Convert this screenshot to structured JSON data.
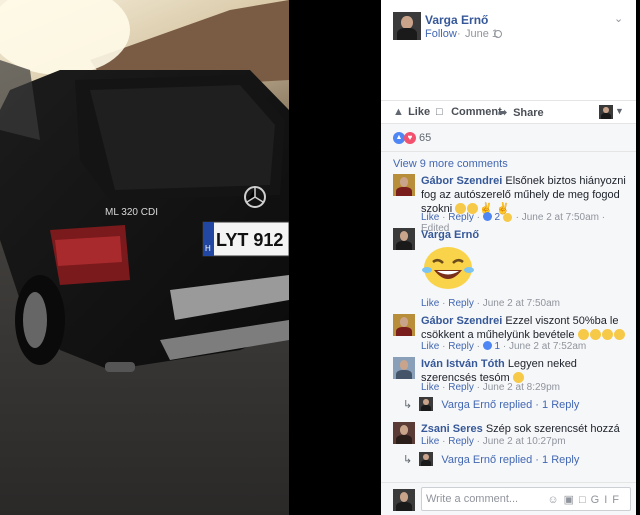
{
  "post": {
    "author": "Varga Ernő",
    "follow_label": "Follow",
    "dot": "·",
    "date": "June 1",
    "menu_icon": "chevron-down-icon"
  },
  "photo": {
    "plate_text": "LYT 912",
    "model_badge": "ML 320 CDI",
    "plate_country": "H"
  },
  "actions": {
    "like": "Like",
    "comment": "Comment",
    "share": "Share"
  },
  "reactions": {
    "count": "65"
  },
  "comments": {
    "view_more": "View 9 more comments",
    "items": [
      {
        "name": "Gábor Szendrei",
        "text": "Elsőnek biztos hiányozni fog az autószerelő műhely de meg fogod szokni",
        "like": "Like",
        "reply": "Reply",
        "reaction_count": "2",
        "time": "June 2 at 7:50am",
        "edited": "Edited"
      },
      {
        "name": "Varga Ernő",
        "text": "",
        "like": "Like",
        "reply": "Reply",
        "time": "June 2 at 7:50am"
      },
      {
        "name": "Gábor Szendrei",
        "text": "Ezzel viszont 50%ba le csökkent a műhelyünk bevétele",
        "like": "Like",
        "reply": "Reply",
        "reaction_count": "1",
        "time": "June 2 at 7:52am"
      },
      {
        "name": "Iván István Tóth",
        "text": "Legyen neked szerencsés tesóm",
        "like": "Like",
        "reply": "Reply",
        "time": "June 2 at 8:29pm",
        "replied_by": "Varga Ernő replied",
        "replies": "1 Reply"
      },
      {
        "name": "Zsani Seres",
        "text": "Szép sok szerencsét hozzá",
        "like": "Like",
        "reply": "Reply",
        "time": "June 2 at 10:27pm",
        "replied_by": "Varga Ernő replied",
        "replies": "1 Reply"
      }
    ]
  },
  "composer": {
    "placeholder": "Write a comment...",
    "gif": "GIF"
  },
  "colors": {
    "link": "#365899",
    "accent": "#4267b2",
    "muted": "#90949c"
  }
}
